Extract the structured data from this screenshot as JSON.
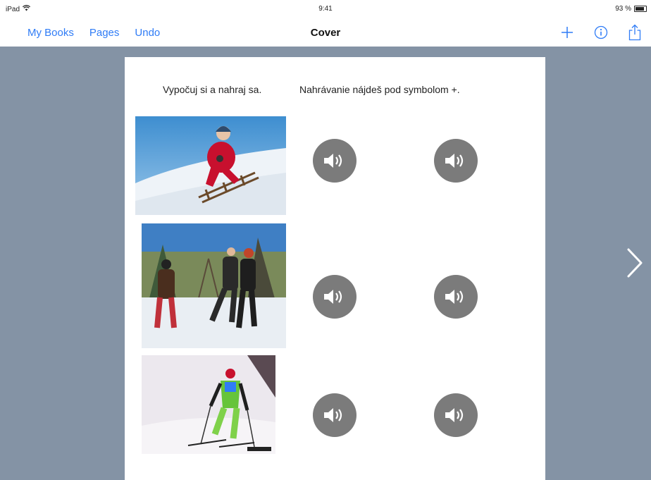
{
  "status": {
    "device": "iPad",
    "time": "9:41",
    "battery": "93 %",
    "battery_level": 0.93
  },
  "nav": {
    "my_books": "My Books",
    "pages": "Pages",
    "undo": "Undo",
    "title": "Cover"
  },
  "icons": {
    "add": "plus-icon",
    "info": "info-icon",
    "share": "share-icon",
    "speaker": "speaker-icon",
    "next": "chevron-right-icon"
  },
  "page": {
    "instruction_left": "Vypočuj si a nahraj sa.",
    "instruction_right": "Nahrávanie nájdeš pod symbolom +."
  },
  "colors": {
    "accent": "#2f7cf6",
    "canvas_bg": "#8493a5",
    "speaker_bg": "#7b7b7b"
  }
}
